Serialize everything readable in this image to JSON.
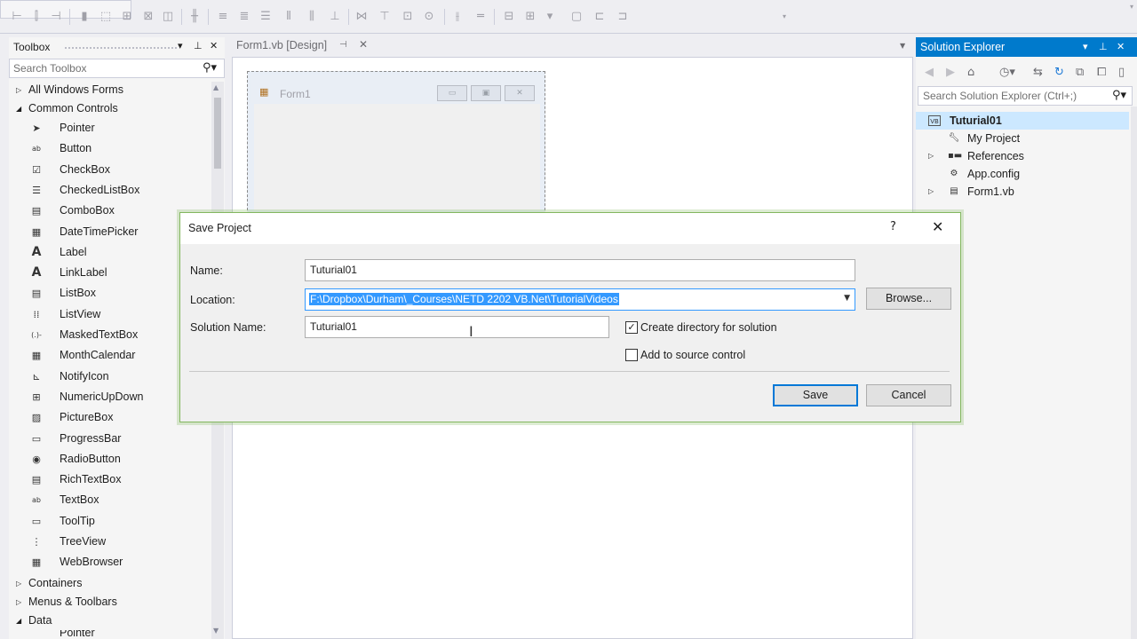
{
  "toolbar": {
    "icons": [
      "align-lefts-icon",
      "align-centers-icon",
      "align-rights-icon",
      "bring-front-icon",
      "send-back-icon",
      "grid-icon",
      "spacing-icon",
      "size-icon",
      "center-icon",
      "order-icon",
      "tab-order-icon",
      "lock-icon",
      "format-icon"
    ]
  },
  "toolbox": {
    "title": "Toolbox",
    "search_placeholder": "Search Toolbox",
    "groups_top": [
      {
        "label": "All Windows Forms",
        "expanded": false
      },
      {
        "label": "Common Controls",
        "expanded": true
      }
    ],
    "items": [
      {
        "label": "Pointer",
        "icon": "pointer-icon"
      },
      {
        "label": "Button",
        "icon": "button-icon"
      },
      {
        "label": "CheckBox",
        "icon": "checkbox-icon"
      },
      {
        "label": "CheckedListBox",
        "icon": "checkedlistbox-icon"
      },
      {
        "label": "ComboBox",
        "icon": "combobox-icon"
      },
      {
        "label": "DateTimePicker",
        "icon": "datetimepicker-icon"
      },
      {
        "label": "Label",
        "icon": "label-icon"
      },
      {
        "label": "LinkLabel",
        "icon": "linklabel-icon"
      },
      {
        "label": "ListBox",
        "icon": "listbox-icon"
      },
      {
        "label": "ListView",
        "icon": "listview-icon"
      },
      {
        "label": "MaskedTextBox",
        "icon": "maskedtextbox-icon"
      },
      {
        "label": "MonthCalendar",
        "icon": "monthcalendar-icon"
      },
      {
        "label": "NotifyIcon",
        "icon": "notifyicon-icon"
      },
      {
        "label": "NumericUpDown",
        "icon": "numericupdown-icon"
      },
      {
        "label": "PictureBox",
        "icon": "picturebox-icon"
      },
      {
        "label": "ProgressBar",
        "icon": "progressbar-icon"
      },
      {
        "label": "RadioButton",
        "icon": "radiobutton-icon"
      },
      {
        "label": "RichTextBox",
        "icon": "richtextbox-icon"
      },
      {
        "label": "TextBox",
        "icon": "textbox-icon"
      },
      {
        "label": "ToolTip",
        "icon": "tooltip-icon"
      },
      {
        "label": "TreeView",
        "icon": "treeview-icon"
      },
      {
        "label": "WebBrowser",
        "icon": "webbrowser-icon"
      }
    ],
    "groups_bottom": [
      {
        "label": "Containers",
        "expanded": false
      },
      {
        "label": "Menus & Toolbars",
        "expanded": false
      },
      {
        "label": "Data",
        "expanded": true
      }
    ],
    "partial_item": "Pointer"
  },
  "document": {
    "tab_label": "Form1.vb [Design]",
    "form_title": "Form1"
  },
  "solution_explorer": {
    "title": "Solution Explorer",
    "search_placeholder": "Search Solution Explorer (Ctrl+;)",
    "project": "Tuturial01",
    "nodes": [
      {
        "label": "My Project",
        "icon": "wrench-icon",
        "expandable": false
      },
      {
        "label": "References",
        "icon": "references-icon",
        "expandable": true
      },
      {
        "label": "App.config",
        "icon": "config-file-icon",
        "expandable": false
      },
      {
        "label": "Form1.vb",
        "icon": "form-file-icon",
        "expandable": true
      }
    ]
  },
  "dialog": {
    "title": "Save Project",
    "help": "?",
    "name_label": "Name:",
    "name_value": "Tuturial01",
    "location_label": "Location:",
    "location_value": "F:\\Dropbox\\Durham\\_Courses\\NETD 2202 VB.Net\\TutorialVideos",
    "browse_label": "Browse...",
    "solution_label": "Solution Name:",
    "solution_value": "Tuturial01",
    "create_dir_label": "Create directory for solution",
    "create_dir_checked": true,
    "source_control_label": "Add to source control",
    "source_control_checked": false,
    "save_label": "Save",
    "cancel_label": "Cancel"
  },
  "colors": {
    "accent": "#007acc",
    "selection": "#3399ff",
    "dialog_border": "#83b75f"
  }
}
